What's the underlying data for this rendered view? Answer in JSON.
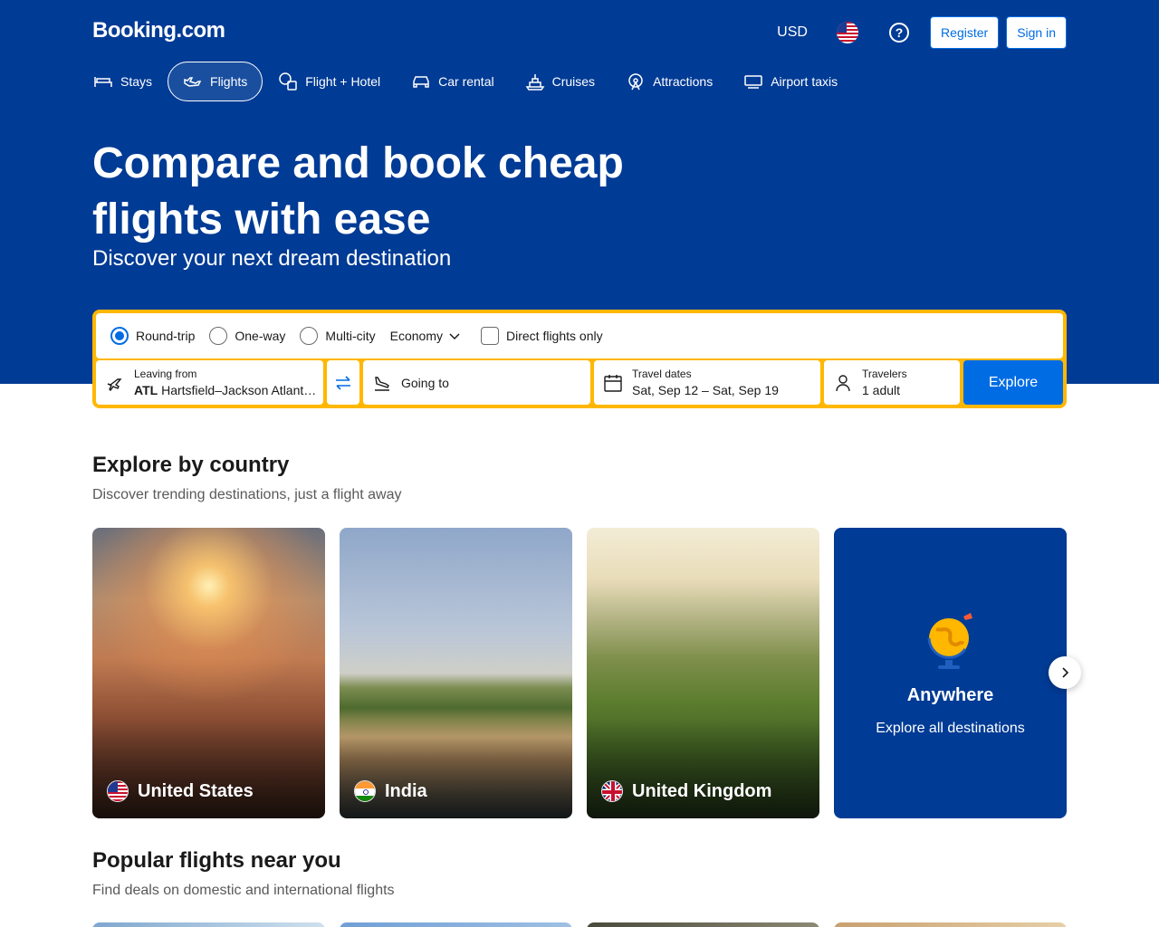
{
  "header": {
    "logo": "Booking.com",
    "currency": "USD",
    "flag_icon": "us-flag-icon",
    "help_icon": "help-icon",
    "register": "Register",
    "sign_in": "Sign in"
  },
  "nav": {
    "items": [
      {
        "label": "Stays",
        "icon": "bed-icon"
      },
      {
        "label": "Flights",
        "icon": "plane-icon",
        "active": true
      },
      {
        "label": "Flight + Hotel",
        "icon": "flight-hotel-icon"
      },
      {
        "label": "Car rental",
        "icon": "car-icon"
      },
      {
        "label": "Cruises",
        "icon": "ship-icon"
      },
      {
        "label": "Attractions",
        "icon": "ferris-wheel-icon"
      },
      {
        "label": "Airport taxis",
        "icon": "taxi-icon"
      }
    ]
  },
  "hero": {
    "title": "Compare and book cheap flights with ease",
    "subtitle": "Discover your next dream destination"
  },
  "search": {
    "trip_types": [
      {
        "label": "Round-trip",
        "checked": true
      },
      {
        "label": "One-way",
        "checked": false
      },
      {
        "label": "Multi-city",
        "checked": false
      }
    ],
    "cabin": "Economy",
    "direct_only": "Direct flights only",
    "leaving_label": "Leaving from",
    "leaving_code": "ATL",
    "leaving_value": "Hartsfield–Jackson Atlant…",
    "going_to": "Going to",
    "dates_label": "Travel dates",
    "dates_value": "Sat, Sep 12 – Sat, Sep 19",
    "travelers_label": "Travelers",
    "travelers_value": "1 adult",
    "explore": "Explore"
  },
  "explore_country": {
    "title": "Explore by country",
    "subtitle": "Discover trending destinations, just a flight away",
    "cards": [
      {
        "label": "United States",
        "flag": "us-flag-icon"
      },
      {
        "label": "India",
        "flag": "india-flag-icon"
      },
      {
        "label": "United Kingdom",
        "flag": "uk-flag-icon"
      }
    ],
    "anywhere": {
      "title": "Anywhere",
      "subtitle": "Explore all destinations",
      "icon": "globe-icon"
    }
  },
  "popular": {
    "title": "Popular flights near you",
    "subtitle": "Find deals on domestic and international flights"
  },
  "colors": {
    "brand_blue": "#003b95",
    "action_blue": "#006ce4",
    "search_border": "#ffb700"
  }
}
